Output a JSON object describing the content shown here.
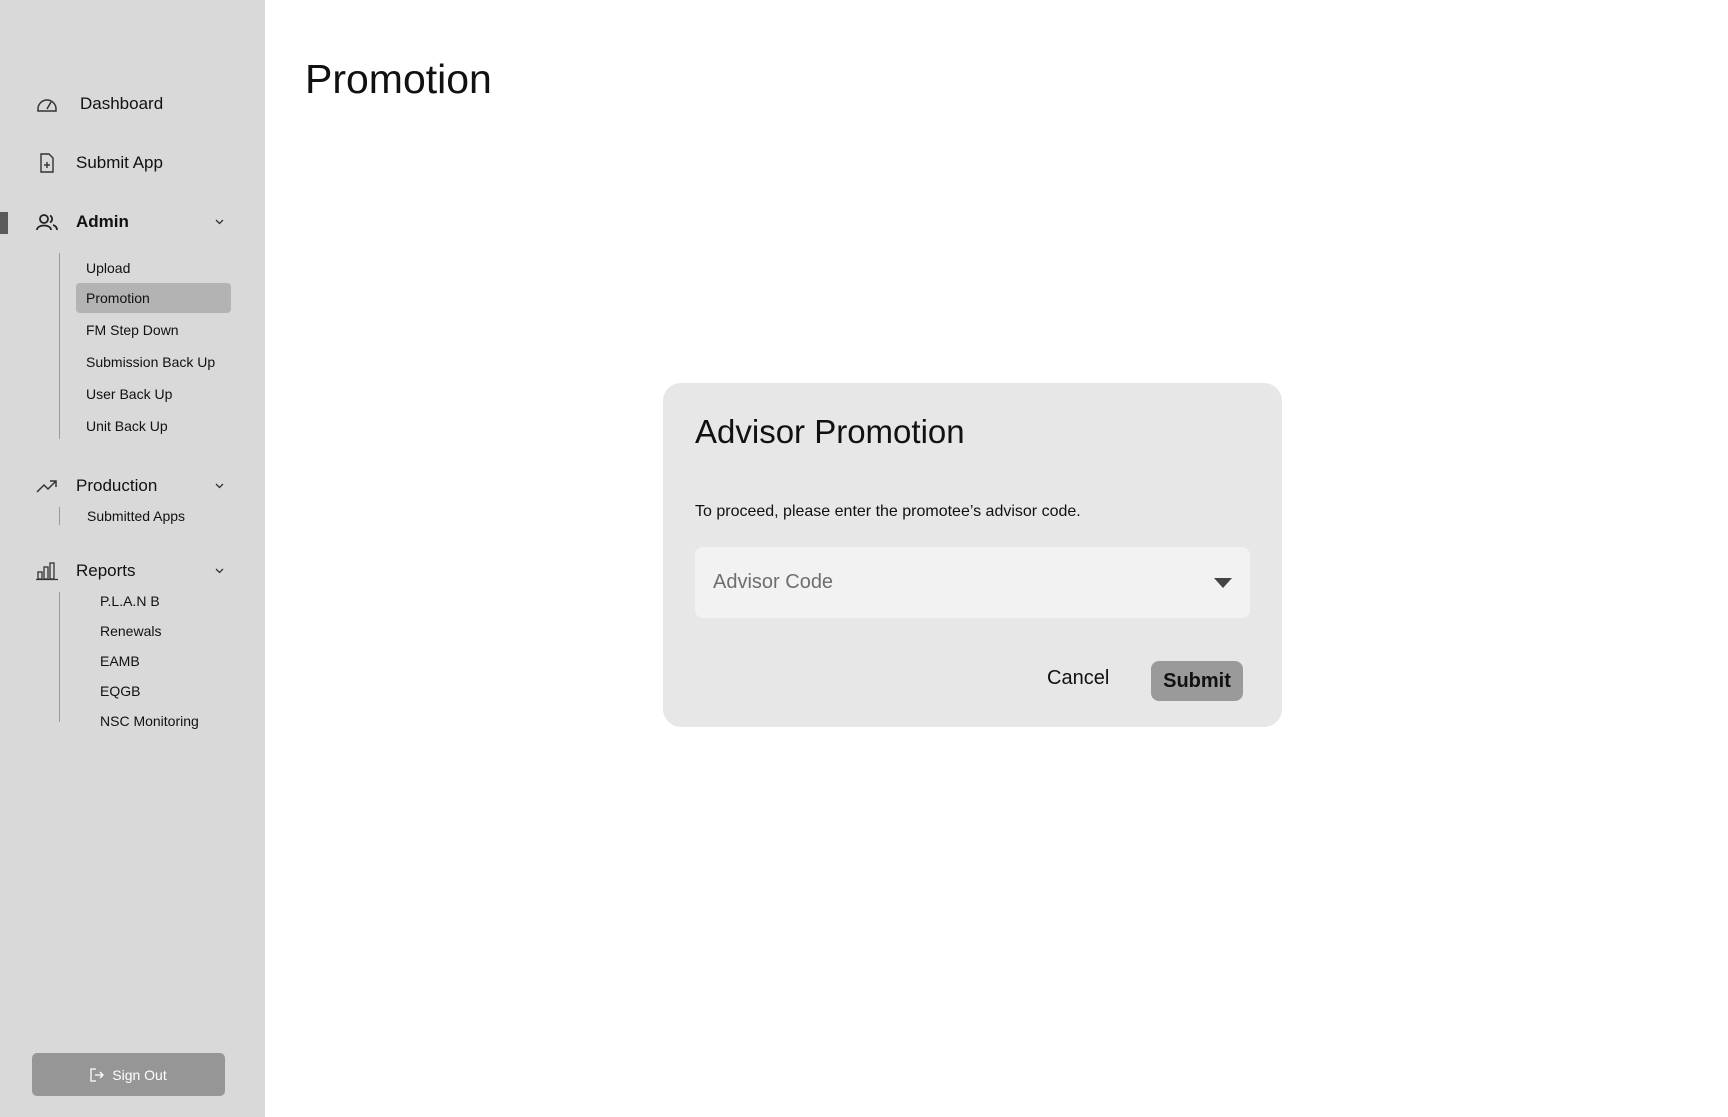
{
  "sidebar": {
    "nav": {
      "dashboard": "Dashboard",
      "submit_app": "Submit App",
      "admin": "Admin",
      "production": "Production",
      "reports": "Reports"
    },
    "admin_items": [
      "Upload",
      "Promotion",
      "FM Step Down",
      "Submission Back Up",
      "User Back Up",
      "Unit Back Up"
    ],
    "production_items": [
      "Submitted Apps"
    ],
    "report_items": [
      "P.L.A.N B",
      "Renewals",
      "EAMB",
      "EQGB",
      "NSC Monitoring"
    ],
    "sign_out": "Sign Out"
  },
  "main": {
    "title": "Promotion"
  },
  "modal": {
    "title": "Advisor Promotion",
    "instruction": "To proceed, please enter the promotee’s advisor code.",
    "select_placeholder": "Advisor Code",
    "cancel_label": "Cancel",
    "submit_label": "Submit"
  },
  "colors": {
    "sidebar_bg": "#d9d9d9",
    "modal_bg": "#e7e7e7",
    "selected_item_bg": "#b3b3b3",
    "button_bg": "#9a9a9a"
  }
}
